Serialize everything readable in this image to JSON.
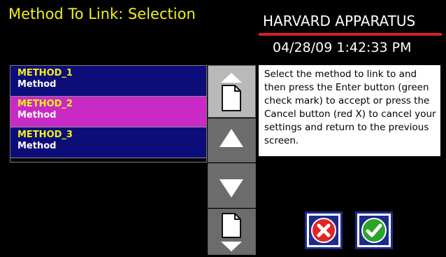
{
  "header": {
    "title": "Method To Link: Selection",
    "brand": "HARVARD APPARATUS",
    "datetime": "04/28/09 1:42:33 PM"
  },
  "methods": [
    {
      "name": "METHOD_1",
      "type": "Method",
      "selected": false
    },
    {
      "name": "METHOD_2",
      "type": "Method",
      "selected": true
    },
    {
      "name": "METHOD_3",
      "type": "Method",
      "selected": false
    }
  ],
  "instructions": "Select the method to link to and then press the Enter button (green check mark) to accept or press the Cancel button (red X) to cancel your settings and return to the previous screen.",
  "icons": {
    "page_up": "page-up-icon",
    "up": "arrow-up-icon",
    "down": "arrow-down-icon",
    "page_down": "page-down-icon",
    "cancel": "red-x-icon",
    "enter": "green-check-icon"
  },
  "colors": {
    "title": "#f2ef1a",
    "selected_row": "#c92ac6",
    "row": "#0d0d7a",
    "cancel": "#e02626",
    "enter": "#2aa52a"
  }
}
